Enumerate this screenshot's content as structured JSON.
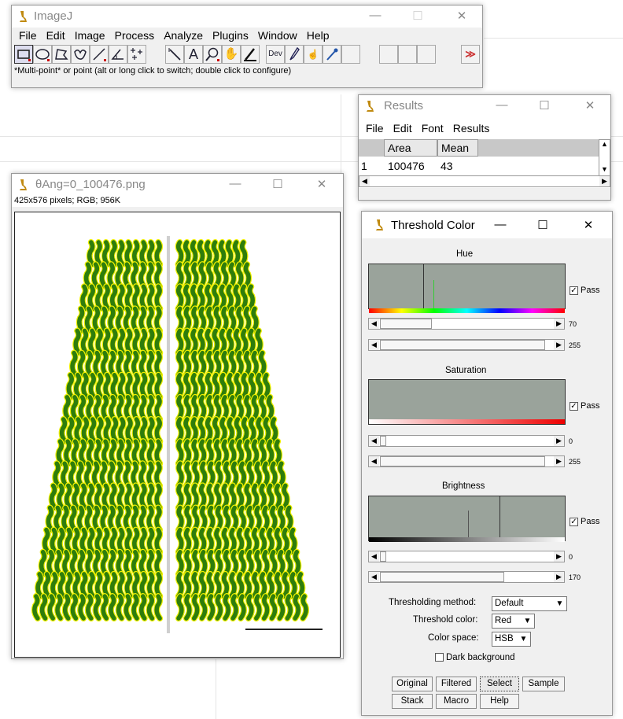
{
  "imagej": {
    "title": "ImageJ",
    "menu": [
      "File",
      "Edit",
      "Image",
      "Process",
      "Analyze",
      "Plugins",
      "Window",
      "Help"
    ],
    "tools": [
      "rectangle-tool",
      "oval-tool",
      "polygon-tool",
      "freehand-tool",
      "line-tool",
      "angle-tool",
      "multipoint-tool",
      "wand-tool",
      "text-tool",
      "magnifier-tool",
      "hand-tool",
      "color-picker-tool"
    ],
    "dev_label": "Dev",
    "status": "*Multi-point* or point (alt or long click to switch; double click to configure)",
    "more_label": "≫"
  },
  "results": {
    "title": "Results",
    "menu": [
      "File",
      "Edit",
      "Font",
      "Results"
    ],
    "headers": [
      "Area",
      "Mean"
    ],
    "rows": [
      {
        "n": "1",
        "area": "100476",
        "mean": "43"
      }
    ]
  },
  "image_window": {
    "title": "θAng=0_100476.png",
    "info": "425x576 pixels; RGB; 956K"
  },
  "threshold": {
    "title": "Threshold Color",
    "sections": [
      {
        "label": "Hue",
        "pass": "Pass",
        "min": "70",
        "max": "255",
        "min_frac": 0.27,
        "max_frac": 1.0
      },
      {
        "label": "Saturation",
        "pass": "Pass",
        "min": "0",
        "max": "255",
        "min_frac": 0.0,
        "max_frac": 1.0
      },
      {
        "label": "Brightness",
        "pass": "Pass",
        "min": "0",
        "max": "170",
        "min_frac": 0.0,
        "max_frac": 0.667
      }
    ],
    "method_label": "Thresholding method:",
    "method_value": "Default",
    "color_label": "Threshold color:",
    "color_value": "Red",
    "space_label": "Color space:",
    "space_value": "HSB",
    "dark_bg": "Dark background",
    "buttons_row1": [
      "Original",
      "Filtered",
      "Select",
      "Sample"
    ],
    "buttons_row2": [
      "Stack",
      "Macro",
      "Help"
    ]
  },
  "colors": {
    "leaf_fill": "#2e7d0c",
    "leaf_edge": "#f0f000",
    "hist_bg": "#9aa39b",
    "accent": "#cc3333"
  }
}
